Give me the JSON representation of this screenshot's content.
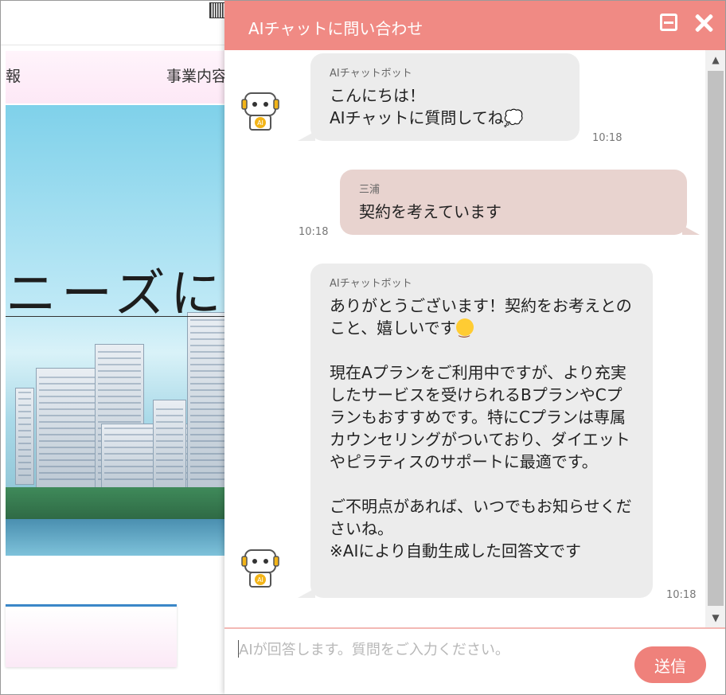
{
  "site": {
    "nav_left": "報",
    "nav_right": "事業内容",
    "hero_text": "ニーズに"
  },
  "chat": {
    "title": "AIチャットに問い合わせ",
    "messages": [
      {
        "role": "bot",
        "sender": "AIチャットボット",
        "text": "こんにちは！\nAIチャットに質問してね💭",
        "time": "10:18"
      },
      {
        "role": "user",
        "sender": "三浦",
        "text": "契約を考えています",
        "time": "10:18"
      },
      {
        "role": "bot",
        "sender": "AIチャットボット",
        "text_part1": "ありがとうございます！契約をお考えとのこと、嬉しいです",
        "text_part2": "\n\n現在Aプランをご利用中ですが、より充実したサービスを受けられるBプランやCプランもおすすめです。特にCプランは専属カウンセリングがついており、ダイエットやピラティスのサポートに最適です。\n\nご不明点があれば、いつでもお知らせくださいね。\n※AIにより自動生成した回答文です",
        "time": "10:18"
      }
    ],
    "input_placeholder": "AIが回答します。質問をご入力ください。",
    "send_label": "送信"
  },
  "colors": {
    "header": "#f08a84",
    "bot_bubble": "#ececec",
    "user_bubble": "#e8d3cf",
    "send_button": "#ef817b"
  },
  "icons": {
    "minimize": "minimize-window-icon",
    "close": "close-icon",
    "avatar": "robot-avatar-icon",
    "emoji": "smiling-face-emoji"
  }
}
